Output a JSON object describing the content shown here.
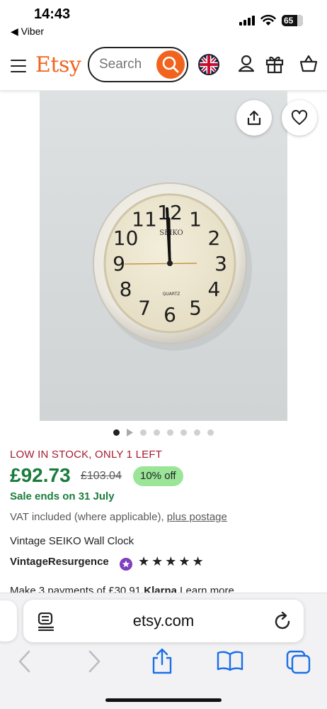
{
  "status_bar": {
    "time": "14:43",
    "back_app": "◀ Viber",
    "battery": "65"
  },
  "header": {
    "logo": "Etsy",
    "search_placeholder": "Search"
  },
  "clock_face": {
    "brand": "SEIKO",
    "quartz": "QUARTZ",
    "numerals": [
      "12",
      "1",
      "2",
      "3",
      "4",
      "5",
      "6",
      "7",
      "8",
      "9",
      "10",
      "11"
    ]
  },
  "carousel": {
    "count": 8,
    "active_index": 0
  },
  "product": {
    "stock": "LOW IN STOCK, ONLY 1 LEFT",
    "price": "£92.73",
    "original_price": "£103.04",
    "discount": "10% off",
    "sale_ends": "Sale ends on 31 July",
    "vat_text": "VAT included (where applicable), ",
    "vat_link": "plus postage",
    "title": "Vintage SEIKO Wall Clock",
    "shop_name": "VintageResurgence",
    "rating_stars": 5,
    "payments_prefix": "Make 3 payments of £30.91",
    "payments_brand": "Klarna",
    "payments_link": "Learn more"
  },
  "browser": {
    "url": "etsy.com"
  },
  "colors": {
    "brand": "#f1641e",
    "price_green": "#1a7c3c",
    "stock_red": "#a61a2e",
    "discount_bg": "#9ae598",
    "safari_blue": "#1a6fe8"
  }
}
